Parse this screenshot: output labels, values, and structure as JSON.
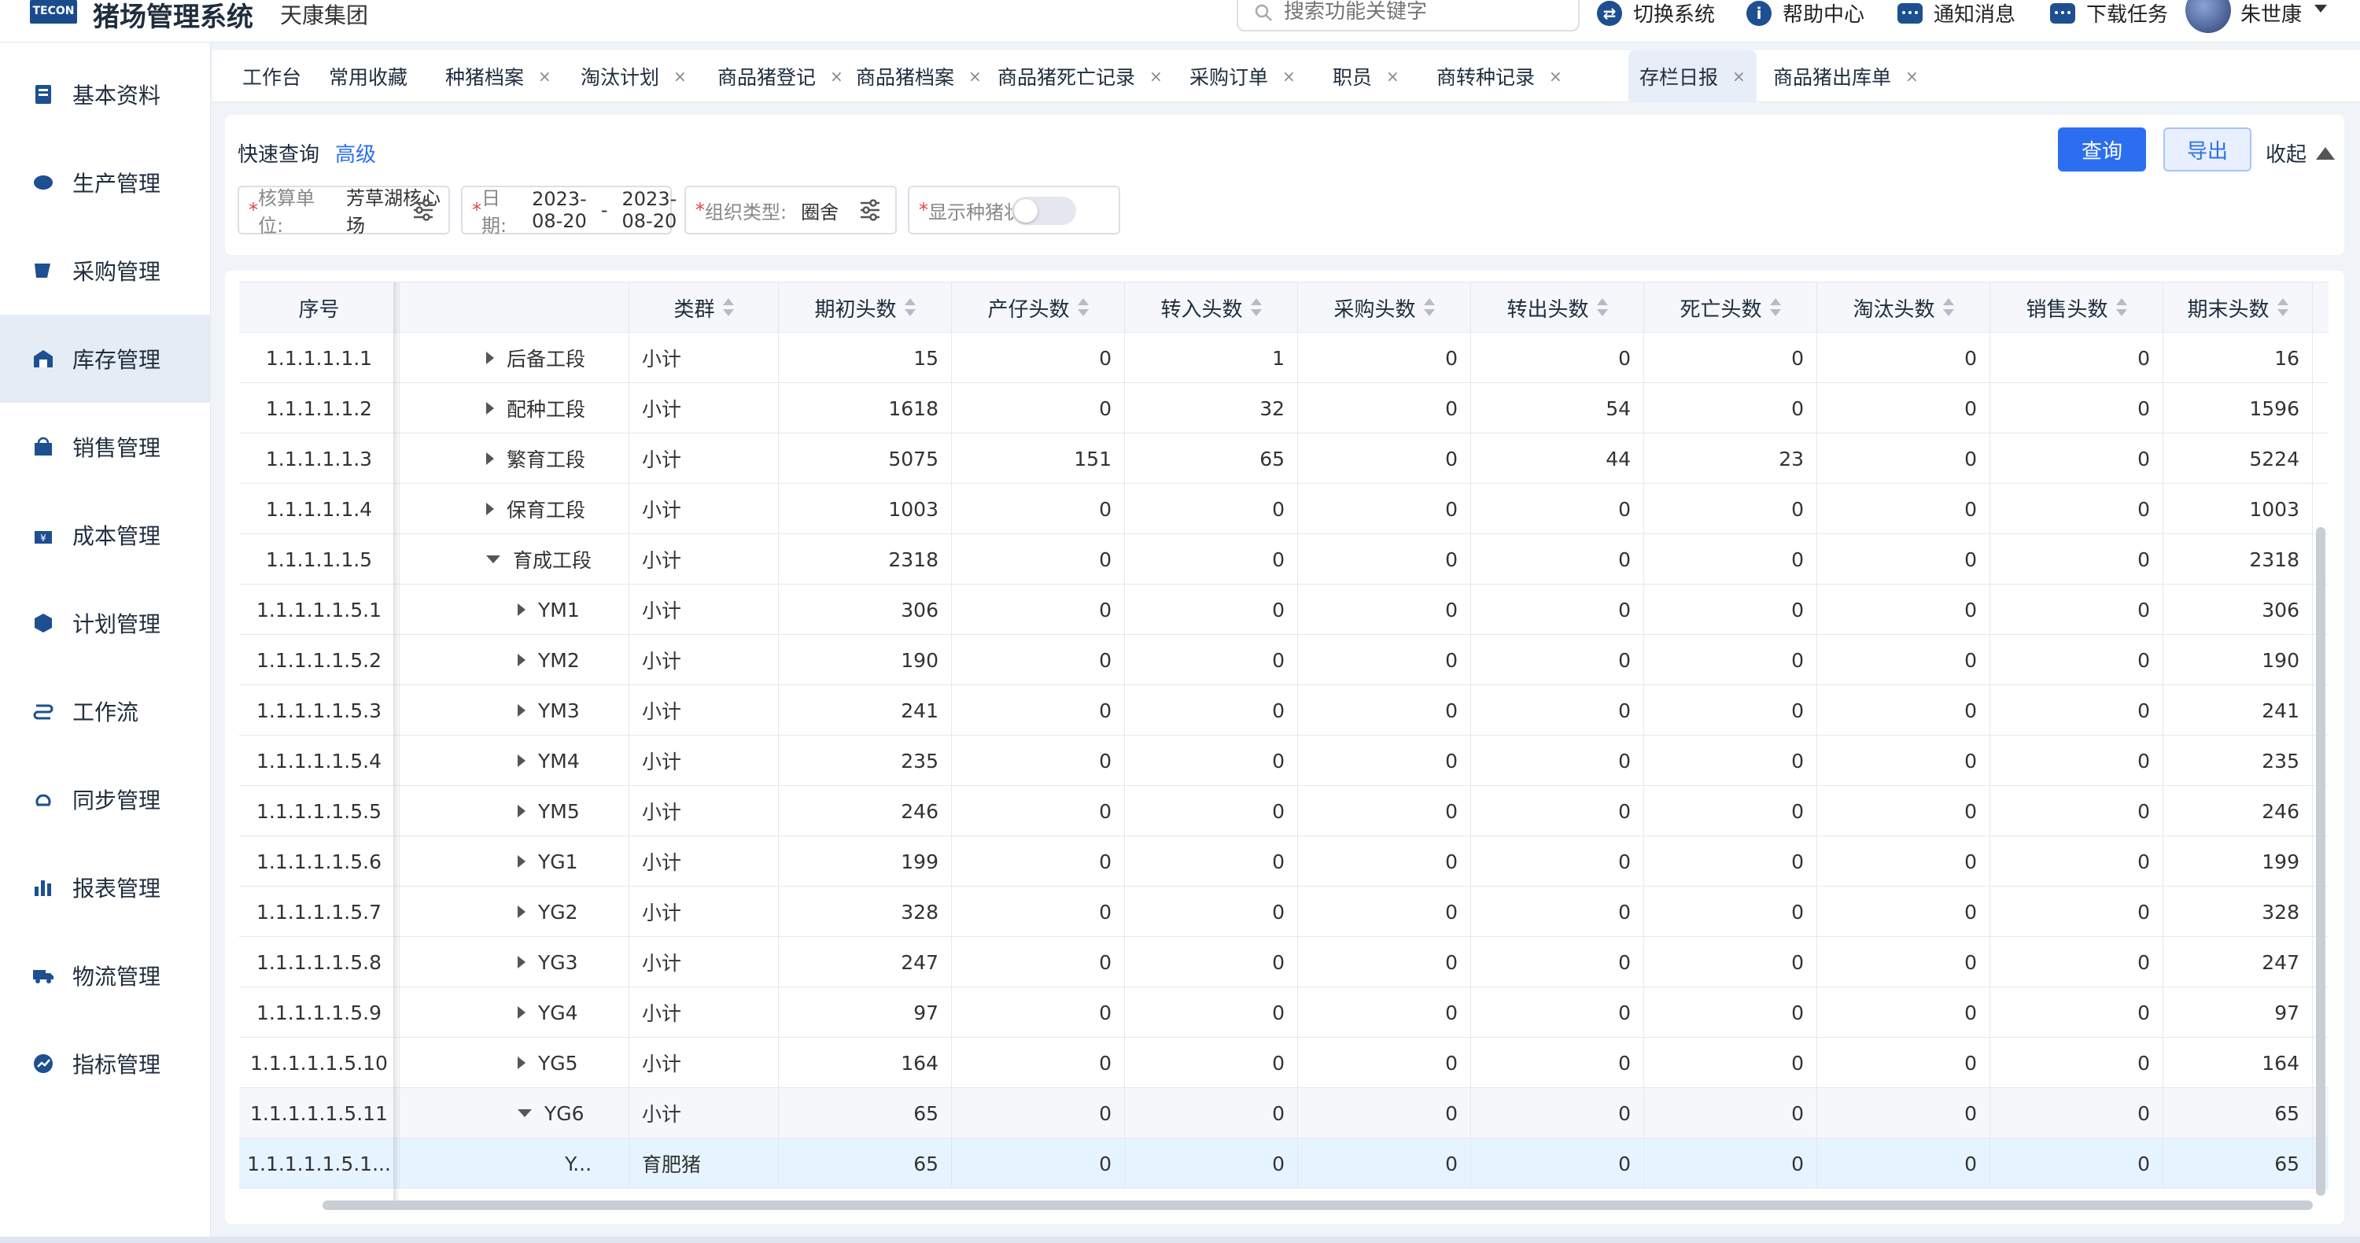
{
  "header": {
    "logo_text": "TECON",
    "title": "猪场管理系统",
    "subtitle": "天康集团",
    "search_placeholder": "搜索功能关键字",
    "actions": [
      {
        "label": "切换系统",
        "icon": "switch-icon"
      },
      {
        "label": "帮助中心",
        "icon": "help-icon"
      },
      {
        "label": "通知消息",
        "icon": "message-icon"
      },
      {
        "label": "下载任务",
        "icon": "download-icon"
      }
    ],
    "user": "朱世康"
  },
  "sidebar": {
    "items": [
      {
        "label": "基本资料",
        "icon": "document-icon"
      },
      {
        "label": "生产管理",
        "icon": "production-icon"
      },
      {
        "label": "采购管理",
        "icon": "purchase-icon"
      },
      {
        "label": "库存管理",
        "icon": "warehouse-icon",
        "active": true
      },
      {
        "label": "销售管理",
        "icon": "sale-icon"
      },
      {
        "label": "成本管理",
        "icon": "cost-icon"
      },
      {
        "label": "计划管理",
        "icon": "plan-icon"
      },
      {
        "label": "工作流",
        "icon": "workflow-icon"
      },
      {
        "label": "同步管理",
        "icon": "sync-icon"
      },
      {
        "label": "报表管理",
        "icon": "report-icon"
      },
      {
        "label": "物流管理",
        "icon": "truck-icon"
      },
      {
        "label": "指标管理",
        "icon": "indicator-icon"
      }
    ]
  },
  "tabs": [
    {
      "label": "工作台",
      "closable": false
    },
    {
      "label": "常用收藏",
      "closable": false
    },
    {
      "label": "种猪档案",
      "closable": true
    },
    {
      "label": "淘汰计划",
      "closable": true
    },
    {
      "label": "商品猪登记",
      "closable": true
    },
    {
      "label": "商品猪档案",
      "closable": true
    },
    {
      "label": "商品猪死亡记录",
      "closable": true
    },
    {
      "label": "采购订单",
      "closable": true
    },
    {
      "label": "职员",
      "closable": true
    },
    {
      "label": "商转种记录",
      "closable": true
    },
    {
      "label": "存栏日报",
      "closable": true,
      "active": true
    },
    {
      "label": "商品猪出库单",
      "closable": true
    }
  ],
  "tab_close": "×",
  "query": {
    "title": "快速查询",
    "advanced": "高级",
    "btn_query": "查询",
    "btn_export": "导出",
    "collapse": "收起",
    "fields": {
      "unit_label": "核算单位:",
      "unit_value": "芳草湖核心场",
      "date_label": "日期:",
      "date_from": "2023-08-20",
      "date_sep": "-",
      "date_to": "2023-08-20",
      "org_label": "组织类型:",
      "org_value": "圈舍",
      "status_label": "显示种猪状态:",
      "status_on": false
    },
    "required_mark": "*"
  },
  "table": {
    "columns": [
      "序号",
      "",
      "类群",
      "期初头数",
      "产仔头数",
      "转入头数",
      "采购头数",
      "转出头数",
      "死亡头数",
      "淘汰头数",
      "销售头数",
      "期末头数"
    ],
    "rows": [
      {
        "seq": "1.1.1.1.1.1",
        "name": "后备工段",
        "level": 0,
        "expand": "right",
        "group": "小计",
        "v": [
          "15",
          "0",
          "1",
          "0",
          "0",
          "0",
          "0",
          "0",
          "16"
        ]
      },
      {
        "seq": "1.1.1.1.1.2",
        "name": "配种工段",
        "level": 0,
        "expand": "right",
        "group": "小计",
        "v": [
          "1618",
          "0",
          "32",
          "0",
          "54",
          "0",
          "0",
          "0",
          "1596"
        ]
      },
      {
        "seq": "1.1.1.1.1.3",
        "name": "繁育工段",
        "level": 0,
        "expand": "right",
        "group": "小计",
        "v": [
          "5075",
          "151",
          "65",
          "0",
          "44",
          "23",
          "0",
          "0",
          "5224"
        ]
      },
      {
        "seq": "1.1.1.1.1.4",
        "name": "保育工段",
        "level": 0,
        "expand": "right",
        "group": "小计",
        "v": [
          "1003",
          "0",
          "0",
          "0",
          "0",
          "0",
          "0",
          "0",
          "1003"
        ]
      },
      {
        "seq": "1.1.1.1.1.5",
        "name": "育成工段",
        "level": 0,
        "expand": "down",
        "group": "小计",
        "v": [
          "2318",
          "0",
          "0",
          "0",
          "0",
          "0",
          "0",
          "0",
          "2318"
        ]
      },
      {
        "seq": "1.1.1.1.1.5.1",
        "name": "YM1",
        "level": 1,
        "expand": "right",
        "group": "小计",
        "v": [
          "306",
          "0",
          "0",
          "0",
          "0",
          "0",
          "0",
          "0",
          "306"
        ]
      },
      {
        "seq": "1.1.1.1.1.5.2",
        "name": "YM2",
        "level": 1,
        "expand": "right",
        "group": "小计",
        "v": [
          "190",
          "0",
          "0",
          "0",
          "0",
          "0",
          "0",
          "0",
          "190"
        ]
      },
      {
        "seq": "1.1.1.1.1.5.3",
        "name": "YM3",
        "level": 1,
        "expand": "right",
        "group": "小计",
        "v": [
          "241",
          "0",
          "0",
          "0",
          "0",
          "0",
          "0",
          "0",
          "241"
        ]
      },
      {
        "seq": "1.1.1.1.1.5.4",
        "name": "YM4",
        "level": 1,
        "expand": "right",
        "group": "小计",
        "v": [
          "235",
          "0",
          "0",
          "0",
          "0",
          "0",
          "0",
          "0",
          "235"
        ]
      },
      {
        "seq": "1.1.1.1.1.5.5",
        "name": "YM5",
        "level": 1,
        "expand": "right",
        "group": "小计",
        "v": [
          "246",
          "0",
          "0",
          "0",
          "0",
          "0",
          "0",
          "0",
          "246"
        ]
      },
      {
        "seq": "1.1.1.1.1.5.6",
        "name": "YG1",
        "level": 1,
        "expand": "right",
        "group": "小计",
        "v": [
          "199",
          "0",
          "0",
          "0",
          "0",
          "0",
          "0",
          "0",
          "199"
        ]
      },
      {
        "seq": "1.1.1.1.1.5.7",
        "name": "YG2",
        "level": 1,
        "expand": "right",
        "group": "小计",
        "v": [
          "328",
          "0",
          "0",
          "0",
          "0",
          "0",
          "0",
          "0",
          "328"
        ]
      },
      {
        "seq": "1.1.1.1.1.5.8",
        "name": "YG3",
        "level": 1,
        "expand": "right",
        "group": "小计",
        "v": [
          "247",
          "0",
          "0",
          "0",
          "0",
          "0",
          "0",
          "0",
          "247"
        ]
      },
      {
        "seq": "1.1.1.1.1.5.9",
        "name": "YG4",
        "level": 1,
        "expand": "right",
        "group": "小计",
        "v": [
          "97",
          "0",
          "0",
          "0",
          "0",
          "0",
          "0",
          "0",
          "97"
        ]
      },
      {
        "seq": "1.1.1.1.1.5.10",
        "name": "YG5",
        "level": 1,
        "expand": "right",
        "group": "小计",
        "v": [
          "164",
          "0",
          "0",
          "0",
          "0",
          "0",
          "0",
          "0",
          "164"
        ]
      },
      {
        "seq": "1.1.1.1.1.5.11",
        "name": "YG6",
        "level": 1,
        "expand": "down",
        "group": "小计",
        "v": [
          "65",
          "0",
          "0",
          "0",
          "0",
          "0",
          "0",
          "0",
          "65"
        ],
        "highlight": true
      },
      {
        "seq": "1.1.1.1.1.5.1...",
        "name": "Y...",
        "level": 2,
        "expand": "",
        "group": "育肥猪",
        "v": [
          "65",
          "0",
          "0",
          "0",
          "0",
          "0",
          "0",
          "0",
          "65"
        ],
        "selected": true
      }
    ]
  }
}
